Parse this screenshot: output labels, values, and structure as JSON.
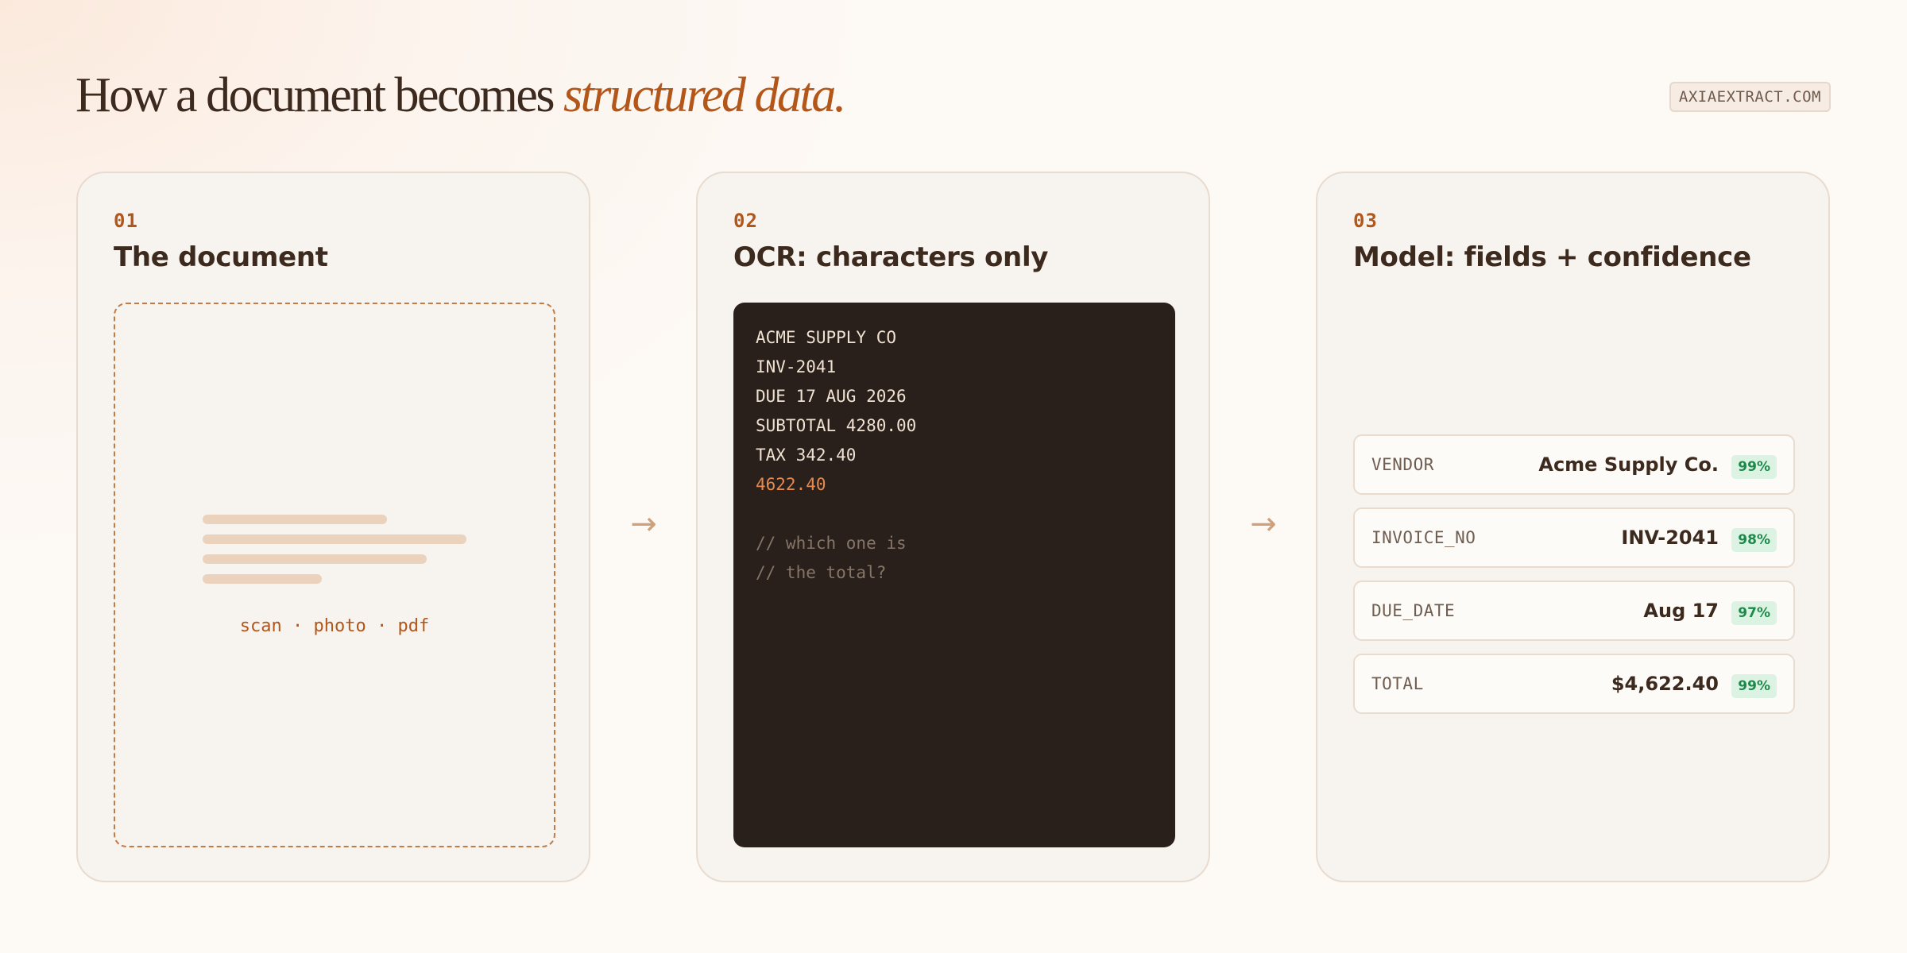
{
  "header": {
    "title_main": "How a document becomes",
    "title_accent": "structured data.",
    "site": "AXIAEXTRACT.COM"
  },
  "steps": [
    {
      "num": "01",
      "title": "The document",
      "caption": "scan · photo · pdf"
    },
    {
      "num": "02",
      "title": "OCR: characters only"
    },
    {
      "num": "03",
      "title": "Model: fields + confidence"
    }
  ],
  "ocr": {
    "lines": [
      "ACME SUPPLY CO",
      "INV-2041",
      "DUE 17 AUG 2026",
      "SUBTOTAL 4280.00",
      "TAX 342.40"
    ],
    "highlight": "4622.40",
    "comments": [
      "// which one is",
      "// the total?"
    ]
  },
  "fields": [
    {
      "key": "VENDOR",
      "value": "Acme Supply Co.",
      "confidence": "99%"
    },
    {
      "key": "INVOICE_NO",
      "value": "INV-2041",
      "confidence": "98%"
    },
    {
      "key": "DUE_DATE",
      "value": "Aug 17",
      "confidence": "97%"
    },
    {
      "key": "TOTAL",
      "value": "$4,622.40",
      "confidence": "99%"
    }
  ],
  "arrows": [
    "→",
    "→"
  ],
  "colors": {
    "accent": "#b3561a",
    "ocr_bg": "#2a201b",
    "confidence_green": "#1e8a4a"
  }
}
